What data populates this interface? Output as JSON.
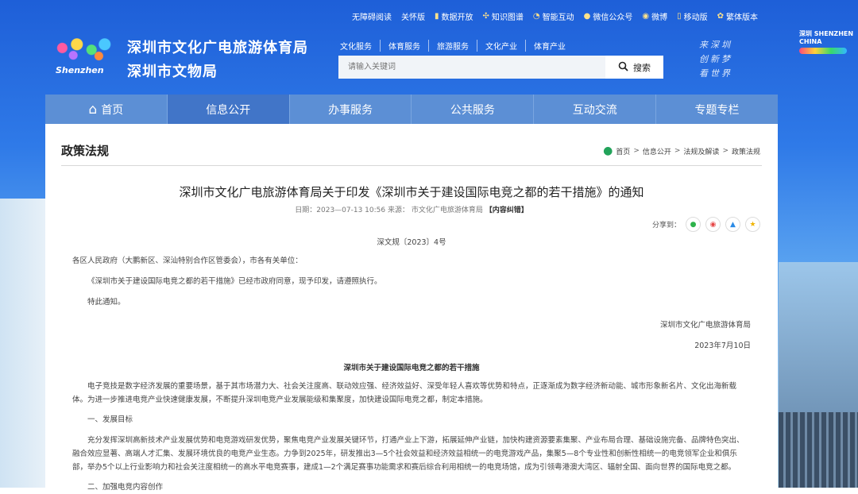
{
  "utility": {
    "items": [
      {
        "label": "无障碍阅读",
        "icon": ""
      },
      {
        "label": "关怀版",
        "icon": ""
      },
      {
        "label": "数据开放",
        "icon": "bar-chart-icon"
      },
      {
        "label": "知识图谱",
        "icon": "graph-icon"
      },
      {
        "label": "智能互动",
        "icon": "chat-icon"
      },
      {
        "label": "微信公众号",
        "icon": "wechat-icon"
      },
      {
        "label": "微博",
        "icon": "weibo-icon"
      },
      {
        "label": "移动版",
        "icon": "mobile-icon"
      },
      {
        "label": "繁体版本",
        "icon": "traditional-icon"
      }
    ]
  },
  "header": {
    "logo_word": "Shenzhen",
    "org_line1": "深圳市文化广电旅游体育局",
    "org_line2": "深圳市文物局",
    "quick_links": [
      "文化服务",
      "体育服务",
      "旅游服务",
      "文化产业",
      "体育产业"
    ],
    "search_placeholder": "请输入关键词",
    "search_button": "搜索",
    "slogan": [
      "来深圳",
      "创新梦",
      "看世界"
    ],
    "brand2": "深圳 SHENZHEN CHINA"
  },
  "nav": {
    "items": [
      "首页",
      "信息公开",
      "办事服务",
      "公共服务",
      "互动交流",
      "专题专栏"
    ],
    "active_index": 1
  },
  "content": {
    "section_title": "政策法规",
    "breadcrumb": [
      "首页",
      "信息公开",
      "法规及解读",
      "政策法规"
    ],
    "article_title": "深圳市文化广电旅游体育局关于印发《深圳市关于建设国际电竞之都的若干措施》的通知",
    "meta": "日期：2023—07-13 10:56 来源： 市文化广电旅游体育局",
    "meta_error": "【内容纠错】",
    "share_label": "分享到：",
    "doc_no": "深文规〔2023〕4号",
    "recipients": "各区人民政府（大鹏新区、深汕特别合作区管委会），市各有关单位：",
    "p1": "《深圳市关于建设国际电竞之都的若干措施》已经市政府同意，现予印发，请遵照执行。",
    "p2": "特此通知。",
    "signature": "深圳市文化广电旅游体育局",
    "date": "2023年7月10日",
    "sub_title": "深圳市关于建设国际电竞之都的若干措施",
    "p3": "电子竞技是数字经济发展的重要场景，基于其市场潜力大、社会关注度高、联动效应强、经济效益好、深受年轻人喜欢等优势和特点，正逐渐成为数字经济新动能、城市形象新名片、文化出海新载体。为进一步推进电竞产业快速健康发展，不断提升深圳电竞产业发展能级和集聚度，加快建设国际电竞之都，制定本措施。",
    "h1": "一、发展目标",
    "p4": "充分发挥深圳高新技术产业发展优势和电竞游戏研发优势，聚焦电竞产业发展关键环节，打通产业上下游，拓展延伸产业链，加快构建资源要素集聚、产业布局合理、基础设施完备、品牌特色突出、融合效应显著、高端人才汇集、发展环境优良的电竞产业生态。力争到2025年，研发推出3—5个社会效益和经济效益相统一的电竞游戏产品，集聚5—8个专业性和创新性相统一的电竞领军企业和俱乐部，举办5个以上行业影响力和社会关注度相统一的高水平电竞赛事，建成1—2个满足赛事功能需求和赛后综合利用相统一的电竞场馆，成为引领粤港澳大湾区、辐射全国、面向世界的国际电竞之都。",
    "h2": "二、加强电竞内容创作"
  }
}
